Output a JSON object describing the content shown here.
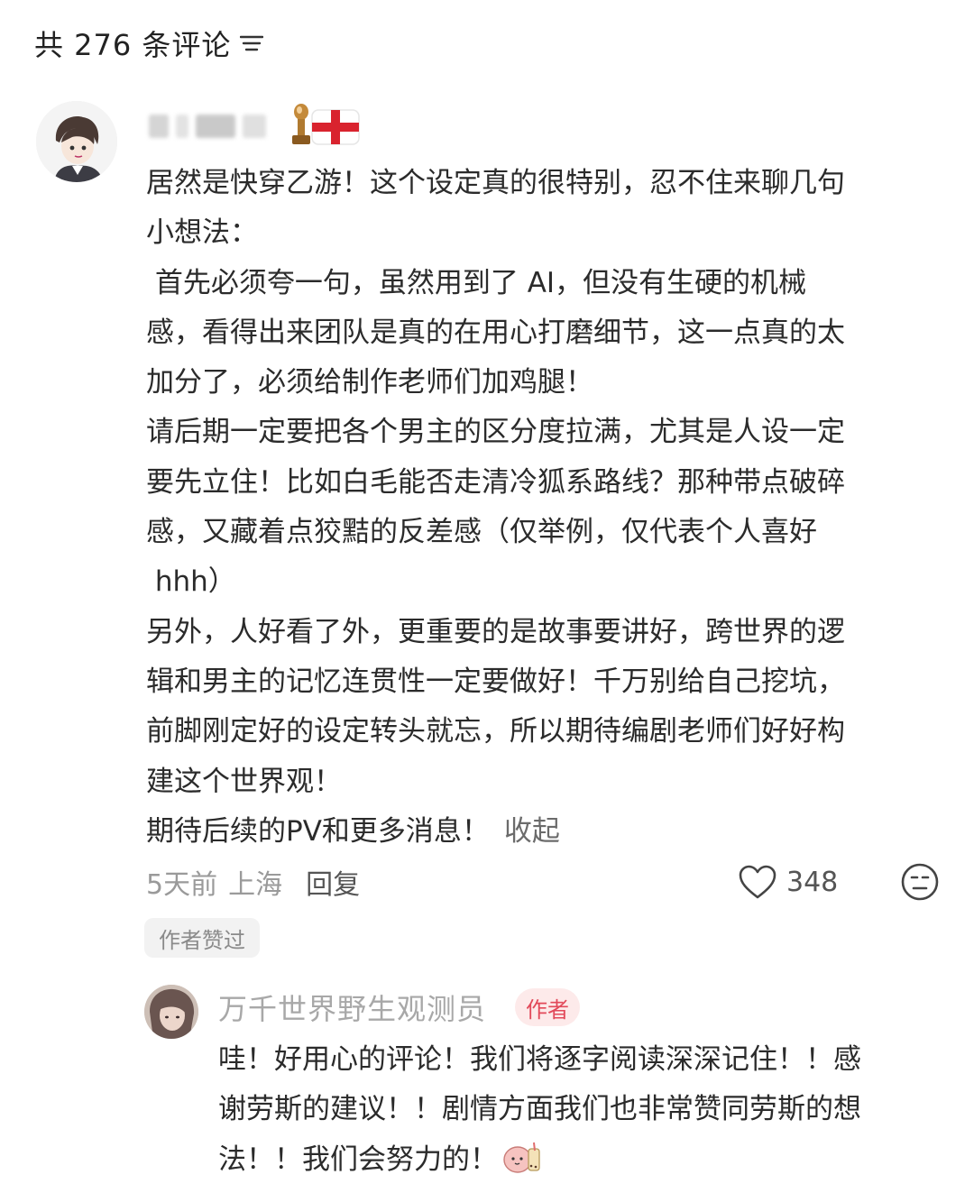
{
  "header": {
    "title": "共 276 条评论",
    "sort_icon": "sort-lines-icon"
  },
  "comment": {
    "avatar_icon": "cartoon-boy-avatar",
    "username_redacted": true,
    "badges": [
      "trophy-icon",
      "england-flag-icon"
    ],
    "lines": [
      "居然是快穿乙游！这个设定真的很特别，忍不住来聊几句",
      "小想法：",
      " 首先必须夸一句，虽然用到了 AI，但没有生硬的机械",
      "感，看得出来团队是真的在用心打磨细节，这一点真的太",
      "加分了，必须给制作老师们加鸡腿！",
      "请后期一定要把各个男主的区分度拉满，尤其是人设一定",
      "要先立住！比如白毛能否走清冷狐系路线？那种带点破碎",
      "感，又藏着点狡黠的反差感（仅举例，仅代表个人喜好",
      " hhh）",
      "另外，人好看了外，更重要的是故事要讲好，跨世界的逻",
      "辑和男主的记忆连贯性一定要做好！千万别给自己挖坑，",
      "前脚刚定好的设定转头就忘，所以期待编剧老师们好好构",
      "建这个世界观！"
    ],
    "last_line": "期待后续的PV和更多消息！",
    "collapse_label": "收起",
    "time": "5天前",
    "location": "上海",
    "reply_label": "回复",
    "like_count": "348",
    "liked_by_author": "作者赞过"
  },
  "reply": {
    "avatar_icon": "anime-character-avatar",
    "name": "万千世界野生观测员",
    "author_tag": "作者",
    "lines": [
      "哇！好用心的评论！我们将逐字阅读深深记住！！感",
      "谢劳斯的建议！！剧情方面我们也非常赞同劳斯的想",
      "法！！我们会努力的！"
    ],
    "sticker_icon": "peach-drink-sticker"
  },
  "colors": {
    "author_tag_bg": "#fdeaea",
    "author_tag_text": "#e2495a",
    "secondary_text": "#9a9a9a"
  }
}
